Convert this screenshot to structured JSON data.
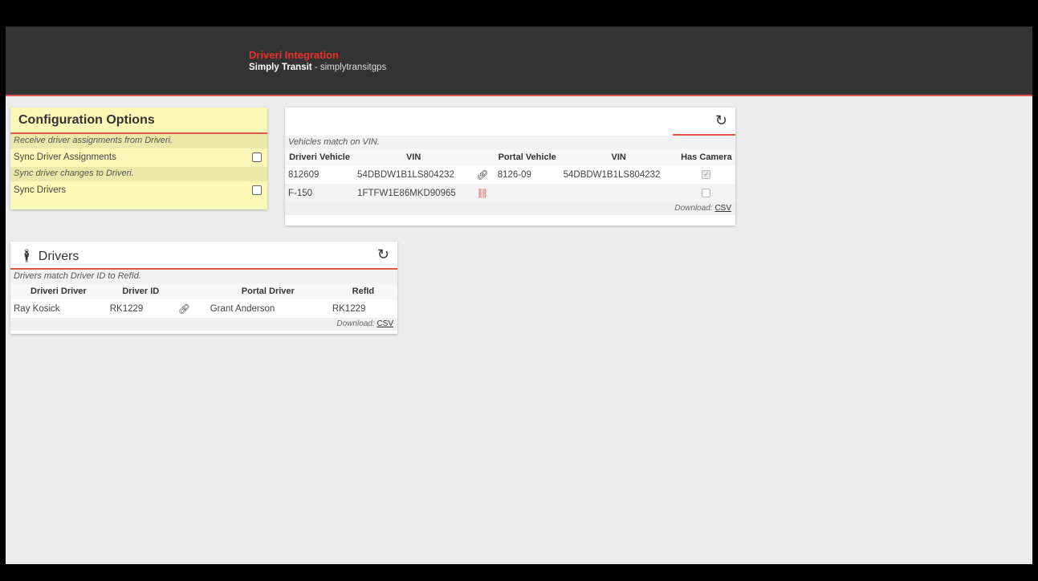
{
  "header": {
    "title": "Driveri Integration",
    "company": "Simply Transit",
    "separator": " - ",
    "account": "simplytransitgps"
  },
  "config": {
    "title": "Configuration Options",
    "note1": "Receive driver assignments from Driveri.",
    "opt1": "Sync Driver Assignments",
    "note2": "Sync driver changes to Driveri.",
    "opt2": "Sync Drivers"
  },
  "vehicles": {
    "refresh_icon": "refresh-icon",
    "note": "Vehicles match on VIN.",
    "headers": [
      "Driveri Vehicle",
      "VIN",
      "Portal Vehicle",
      "VIN",
      "Has Camera"
    ],
    "rows": [
      {
        "driveri_vehicle": "812609",
        "vin": "54DBDW1B1LS804232",
        "portal_vehicle": "8126-09",
        "portal_vin": "54DBDW1B1LS804232",
        "has_camera": true,
        "linked": true
      },
      {
        "driveri_vehicle": "F-150",
        "vin": "1FTFW1E86MKD90965",
        "portal_vehicle": "",
        "portal_vin": "",
        "has_camera": false,
        "linked": false
      }
    ],
    "download_label": "Download:",
    "csv": "CSV"
  },
  "drivers": {
    "title": "Drivers",
    "note": "Drivers match Driver ID to RefId.",
    "headers": [
      "Driveri Driver",
      "Driver ID",
      "Portal Driver",
      "RefId"
    ],
    "rows": [
      {
        "driveri_driver": "Ray Kosick",
        "driver_id": "RK1229",
        "portal_driver": "Grant Anderson",
        "refid": "RK1229"
      }
    ],
    "download_label": "Download:",
    "csv": "CSV"
  },
  "colors": {
    "accent": "#e2554a",
    "title_red": "#e8332a",
    "header_bg": "#333333",
    "config_bg": "#faf7b7"
  }
}
